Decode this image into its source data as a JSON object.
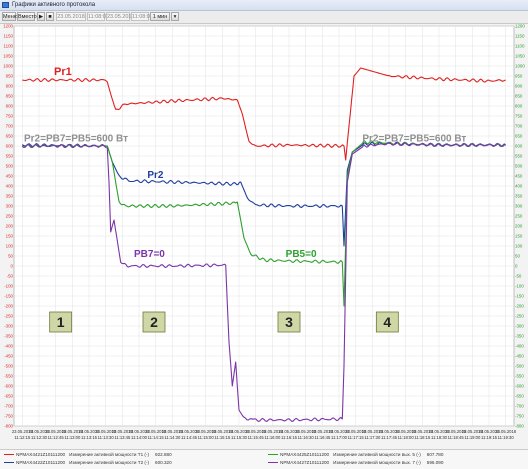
{
  "window": {
    "title": "Графики активного протокола"
  },
  "toolbar": {
    "btn1": "Меню",
    "btn2": "Вместо",
    "date1": "23.05.2018",
    "time1": "11:08:00",
    "date2": "23.05.2018",
    "time2": "11:08:00",
    "span": "1 мин"
  },
  "colors": {
    "red": "#e02020",
    "blue": "#1f3f9e",
    "green": "#2ea02e",
    "purple": "#7b35a8"
  },
  "chart_data": {
    "type": "line",
    "ylim": [
      -800,
      1200
    ],
    "yticks": [
      1200,
      1150,
      1100,
      1050,
      1000,
      950,
      900,
      850,
      800,
      750,
      700,
      650,
      600,
      550,
      500,
      450,
      400,
      350,
      300,
      250,
      200,
      150,
      100,
      50,
      0,
      -50,
      -100,
      -150,
      -200,
      -250,
      -300,
      -350,
      -400,
      -450,
      -500,
      -550,
      -600,
      -650,
      -700,
      -750,
      -800
    ],
    "x": [
      "11:12:15",
      "11:12:30",
      "11:12:45",
      "11:13:00",
      "11:13:15",
      "11:13:30",
      "11:13:45",
      "11:14:00",
      "11:14:15",
      "11:14:30",
      "11:14:45",
      "11:15:00",
      "11:15:15",
      "11:15:30",
      "11:15:45",
      "11:16:00",
      "11:16:15",
      "11:16:30",
      "11:16:45",
      "11:17:00",
      "11:17:15",
      "11:17:30",
      "11:17:45",
      "11:18:00",
      "11:18:15",
      "11:18:30",
      "11:18:45",
      "11:19:00",
      "11:19:15",
      "11:19:30"
    ],
    "x_date": "23.05.2018",
    "grid": true,
    "series": [
      {
        "name": "Pr1",
        "color": "#e02020",
        "x": [
          0,
          4.9,
          5.1,
          5.3,
          5.6,
          6.2,
          9,
          12,
          12.9,
          13.2,
          13.6,
          14,
          16,
          19.3,
          19.4,
          19.6,
          19.9,
          20.3,
          22,
          25,
          28,
          29
        ],
        "values": [
          930,
          930,
          920,
          860,
          780,
          810,
          825,
          838,
          830,
          760,
          620,
          600,
          605,
          600,
          530,
          700,
          950,
          990,
          950,
          935,
          925,
          930
        ]
      },
      {
        "name": "Pr2",
        "color": "#1f3f9e",
        "x": [
          0,
          4.9,
          5.1,
          5.4,
          5.8,
          6.4,
          9,
          12.8,
          13.1,
          13.5,
          14,
          16,
          19.2,
          19.3,
          19.5,
          19.8,
          20.5,
          22,
          25,
          29
        ],
        "values": [
          605,
          600,
          600,
          520,
          450,
          425,
          420,
          410,
          420,
          340,
          305,
          300,
          300,
          100,
          480,
          570,
          610,
          612,
          605,
          605
        ]
      },
      {
        "name": "PB5",
        "color": "#2ea02e",
        "x": [
          0,
          4.9,
          5.1,
          5.4,
          5.8,
          6.2,
          9,
          12.8,
          12.9,
          13.1,
          13.3,
          13.7,
          14.5,
          16,
          19.2,
          19.3,
          19.5,
          19.8,
          20.5,
          22,
          25,
          29
        ],
        "values": [
          600,
          600,
          600,
          520,
          320,
          300,
          300,
          315,
          320,
          230,
          140,
          60,
          30,
          25,
          20,
          -200,
          450,
          570,
          620,
          615,
          605,
          605
        ]
      },
      {
        "name": "PB7",
        "color": "#7b35a8",
        "x": [
          0,
          4.9,
          5.1,
          5.2,
          5.3,
          5.5,
          5.9,
          6.3,
          9,
          12.2,
          12.4,
          12.6,
          12.8,
          13.0,
          13.3,
          14,
          16,
          19.2,
          19.3,
          19.5,
          19.8,
          20.5,
          22,
          25,
          29
        ],
        "values": [
          600,
          600,
          590,
          420,
          170,
          230,
          20,
          0,
          0,
          5,
          -380,
          -600,
          -480,
          -720,
          -760,
          -770,
          -770,
          -765,
          -500,
          420,
          560,
          600,
          612,
          605,
          605
        ]
      }
    ],
    "annotations": [
      "Pr1",
      "Pr2=PB7=PB5=600 Вт",
      "Pr2",
      "PB7=0",
      "PB5=0",
      "Pr2=PB7=PB5=600 Вт"
    ],
    "regions": [
      "1",
      "2",
      "3",
      "4"
    ]
  },
  "legend": [
    {
      "id": "NPMAX4421Z10111200",
      "desc": "Измерение активной мощности Т1 (‑)",
      "val": "922.880",
      "color": "#e02020"
    },
    {
      "id": "NPMAX4422Z10111200",
      "desc": "Измерение активной мощности Т2 (‑)",
      "val": "600.320",
      "color": "#1f3f9e"
    },
    {
      "id": "NPMAX4425Z10111200",
      "desc": "Измерение активной мощности вых. 5 (‑)",
      "val": "607.780",
      "color": "#2ea02e"
    },
    {
      "id": "NPMAX4427Z10111200",
      "desc": "Измерение активной мощности вых. 7 (‑)",
      "val": "596.090",
      "color": "#7b35a8"
    }
  ]
}
